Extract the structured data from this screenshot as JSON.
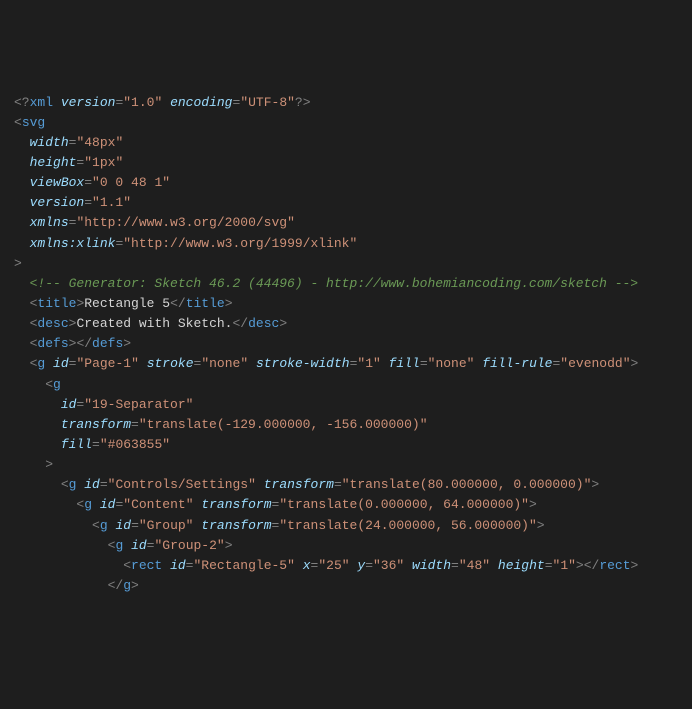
{
  "code": [
    [
      [
        "punct",
        "<?"
      ],
      [
        "tag",
        "xml"
      ],
      [
        "text",
        " "
      ],
      [
        "attr",
        "version"
      ],
      [
        "punct",
        "="
      ],
      [
        "str",
        "\"1.0\""
      ],
      [
        "text",
        " "
      ],
      [
        "attr",
        "encoding"
      ],
      [
        "punct",
        "="
      ],
      [
        "str",
        "\"UTF-8\""
      ],
      [
        "punct",
        "?>"
      ]
    ],
    [
      [
        "punct",
        "<"
      ],
      [
        "tag",
        "svg"
      ]
    ],
    [
      [
        "text",
        "  "
      ],
      [
        "attr",
        "width"
      ],
      [
        "punct",
        "="
      ],
      [
        "str",
        "\"48px\""
      ]
    ],
    [
      [
        "text",
        "  "
      ],
      [
        "attr",
        "height"
      ],
      [
        "punct",
        "="
      ],
      [
        "str",
        "\"1px\""
      ]
    ],
    [
      [
        "text",
        "  "
      ],
      [
        "attr",
        "viewBox"
      ],
      [
        "punct",
        "="
      ],
      [
        "str",
        "\"0 0 48 1\""
      ]
    ],
    [
      [
        "text",
        "  "
      ],
      [
        "attr",
        "version"
      ],
      [
        "punct",
        "="
      ],
      [
        "str",
        "\"1.1\""
      ]
    ],
    [
      [
        "text",
        "  "
      ],
      [
        "attr",
        "xmlns"
      ],
      [
        "punct",
        "="
      ],
      [
        "str",
        "\"http://www.w3.org/2000/svg\""
      ]
    ],
    [
      [
        "text",
        "  "
      ],
      [
        "attr",
        "xmlns:xlink"
      ],
      [
        "punct",
        "="
      ],
      [
        "str",
        "\"http://www.w3.org/1999/xlink\""
      ]
    ],
    [
      [
        "punct",
        ">"
      ]
    ],
    [
      [
        "text",
        "  "
      ],
      [
        "comment",
        "<!-- Generator: Sketch 46.2 (44496) - http://www.bohemiancoding.com/sketch -->"
      ]
    ],
    [
      [
        "text",
        "  "
      ],
      [
        "punct",
        "<"
      ],
      [
        "tag",
        "title"
      ],
      [
        "punct",
        ">"
      ],
      [
        "text",
        "Rectangle 5"
      ],
      [
        "punct",
        "</"
      ],
      [
        "tag",
        "title"
      ],
      [
        "punct",
        ">"
      ]
    ],
    [
      [
        "text",
        "  "
      ],
      [
        "punct",
        "<"
      ],
      [
        "tag",
        "desc"
      ],
      [
        "punct",
        ">"
      ],
      [
        "text",
        "Created with Sketch."
      ],
      [
        "punct",
        "</"
      ],
      [
        "tag",
        "desc"
      ],
      [
        "punct",
        ">"
      ]
    ],
    [
      [
        "text",
        "  "
      ],
      [
        "punct",
        "<"
      ],
      [
        "tag",
        "defs"
      ],
      [
        "punct",
        "></"
      ],
      [
        "tag",
        "defs"
      ],
      [
        "punct",
        ">"
      ]
    ],
    [
      [
        "text",
        "  "
      ],
      [
        "punct",
        "<"
      ],
      [
        "tag",
        "g"
      ],
      [
        "text",
        " "
      ],
      [
        "attr",
        "id"
      ],
      [
        "punct",
        "="
      ],
      [
        "str",
        "\"Page-1\""
      ],
      [
        "text",
        " "
      ],
      [
        "attr",
        "stroke"
      ],
      [
        "punct",
        "="
      ],
      [
        "str",
        "\"none\""
      ],
      [
        "text",
        " "
      ],
      [
        "attr",
        "stroke-width"
      ],
      [
        "punct",
        "="
      ],
      [
        "str",
        "\"1\""
      ],
      [
        "text",
        " "
      ],
      [
        "attr",
        "fill"
      ],
      [
        "punct",
        "="
      ],
      [
        "str",
        "\"none\""
      ],
      [
        "text",
        " "
      ],
      [
        "attr",
        "fill-rule"
      ],
      [
        "punct",
        "="
      ],
      [
        "str",
        "\"evenodd\""
      ],
      [
        "punct",
        ">"
      ]
    ],
    [
      [
        "text",
        "    "
      ],
      [
        "punct",
        "<"
      ],
      [
        "tag",
        "g"
      ]
    ],
    [
      [
        "text",
        "      "
      ],
      [
        "attr",
        "id"
      ],
      [
        "punct",
        "="
      ],
      [
        "str",
        "\"19-Separator\""
      ]
    ],
    [
      [
        "text",
        "      "
      ],
      [
        "attr",
        "transform"
      ],
      [
        "punct",
        "="
      ],
      [
        "str",
        "\"translate(-129.000000, -156.000000)\""
      ]
    ],
    [
      [
        "text",
        "      "
      ],
      [
        "attr",
        "fill"
      ],
      [
        "punct",
        "="
      ],
      [
        "str",
        "\"#063855\""
      ]
    ],
    [
      [
        "text",
        "    "
      ],
      [
        "punct",
        ">"
      ]
    ],
    [
      [
        "text",
        "      "
      ],
      [
        "punct",
        "<"
      ],
      [
        "tag",
        "g"
      ],
      [
        "text",
        " "
      ],
      [
        "attr",
        "id"
      ],
      [
        "punct",
        "="
      ],
      [
        "str",
        "\"Controls/Settings\""
      ],
      [
        "text",
        " "
      ],
      [
        "attr",
        "transform"
      ],
      [
        "punct",
        "="
      ],
      [
        "str",
        "\"translate(80.000000, 0.000000)\""
      ],
      [
        "punct",
        ">"
      ]
    ],
    [
      [
        "text",
        "        "
      ],
      [
        "punct",
        "<"
      ],
      [
        "tag",
        "g"
      ],
      [
        "text",
        " "
      ],
      [
        "attr",
        "id"
      ],
      [
        "punct",
        "="
      ],
      [
        "str",
        "\"Content\""
      ],
      [
        "text",
        " "
      ],
      [
        "attr",
        "transform"
      ],
      [
        "punct",
        "="
      ],
      [
        "str",
        "\"translate(0.000000, 64.000000)\""
      ],
      [
        "punct",
        ">"
      ]
    ],
    [
      [
        "text",
        "          "
      ],
      [
        "punct",
        "<"
      ],
      [
        "tag",
        "g"
      ],
      [
        "text",
        " "
      ],
      [
        "attr",
        "id"
      ],
      [
        "punct",
        "="
      ],
      [
        "str",
        "\"Group\""
      ],
      [
        "text",
        " "
      ],
      [
        "attr",
        "transform"
      ],
      [
        "punct",
        "="
      ],
      [
        "str",
        "\"translate(24.000000, 56.000000)\""
      ],
      [
        "punct",
        ">"
      ]
    ],
    [
      [
        "text",
        "            "
      ],
      [
        "punct",
        "<"
      ],
      [
        "tag",
        "g"
      ],
      [
        "text",
        " "
      ],
      [
        "attr",
        "id"
      ],
      [
        "punct",
        "="
      ],
      [
        "str",
        "\"Group-2\""
      ],
      [
        "punct",
        ">"
      ]
    ],
    [
      [
        "text",
        "              "
      ],
      [
        "punct",
        "<"
      ],
      [
        "tag",
        "rect"
      ],
      [
        "text",
        " "
      ],
      [
        "attr",
        "id"
      ],
      [
        "punct",
        "="
      ],
      [
        "str",
        "\"Rectangle-5\""
      ],
      [
        "text",
        " "
      ],
      [
        "attr",
        "x"
      ],
      [
        "punct",
        "="
      ],
      [
        "str",
        "\"25\""
      ],
      [
        "text",
        " "
      ],
      [
        "attr",
        "y"
      ],
      [
        "punct",
        "="
      ],
      [
        "str",
        "\"36\""
      ],
      [
        "text",
        " "
      ],
      [
        "attr",
        "width"
      ],
      [
        "punct",
        "="
      ],
      [
        "str",
        "\"48\""
      ],
      [
        "text",
        " "
      ],
      [
        "attr",
        "height"
      ],
      [
        "punct",
        "="
      ],
      [
        "str",
        "\"1\""
      ],
      [
        "punct",
        "></"
      ],
      [
        "tag",
        "rect"
      ],
      [
        "punct",
        ">"
      ]
    ],
    [
      [
        "text",
        "            "
      ],
      [
        "punct",
        "</"
      ],
      [
        "tag",
        "g"
      ],
      [
        "punct",
        ">"
      ]
    ]
  ]
}
